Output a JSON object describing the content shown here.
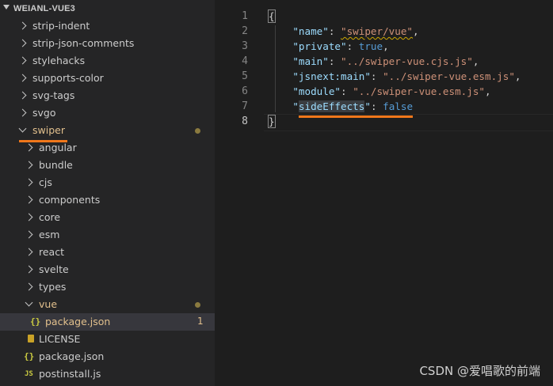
{
  "explorer": {
    "title": "WEIANL-VUE3",
    "rows": [
      {
        "label": "strip-indent"
      },
      {
        "label": "strip-json-comments"
      },
      {
        "label": "stylehacks"
      },
      {
        "label": "supports-color"
      },
      {
        "label": "svg-tags"
      },
      {
        "label": "svgo"
      },
      {
        "label": "swiper",
        "expanded": true,
        "modified": true
      },
      {
        "label": "angular"
      },
      {
        "label": "bundle"
      },
      {
        "label": "cjs"
      },
      {
        "label": "components"
      },
      {
        "label": "core"
      },
      {
        "label": "esm"
      },
      {
        "label": "react"
      },
      {
        "label": "svelte"
      },
      {
        "label": "types"
      },
      {
        "label": "vue",
        "expanded": true,
        "modified": true
      },
      {
        "label": "package.json",
        "badge": "1",
        "selected": true
      },
      {
        "label": "LICENSE"
      },
      {
        "label": "package.json"
      },
      {
        "label": "postinstall.js"
      }
    ],
    "icons": {
      "json": "{}",
      "js": "JS"
    }
  },
  "editor": {
    "line_numbers": [
      "1",
      "2",
      "3",
      "4",
      "5",
      "6",
      "7",
      "8"
    ],
    "lines": {
      "l1_open": "{",
      "l2_key": "\"name\"",
      "l2_val": "\"swiper/vue\"",
      "l3_key": "\"private\"",
      "l3_val": "true",
      "l4_key": "\"main\"",
      "l4_val": "\"../swiper-vue.cjs.js\"",
      "l5_key": "\"jsnext:main\"",
      "l5_val": "\"../swiper-vue.esm.js\"",
      "l6_key": "\"module\"",
      "l6_val": "\"../swiper-vue.esm.js\"",
      "l7_q": "\"",
      "l7_key": "sideEffects",
      "l7_val": "false",
      "l8_close": "}"
    },
    "colors": {
      "key": "#9cdcfe",
      "string": "#ce9178",
      "boolean": "#569cd6",
      "annotation": "#f0771b"
    }
  },
  "watermark": "CSDN @爱唱歌的前端"
}
